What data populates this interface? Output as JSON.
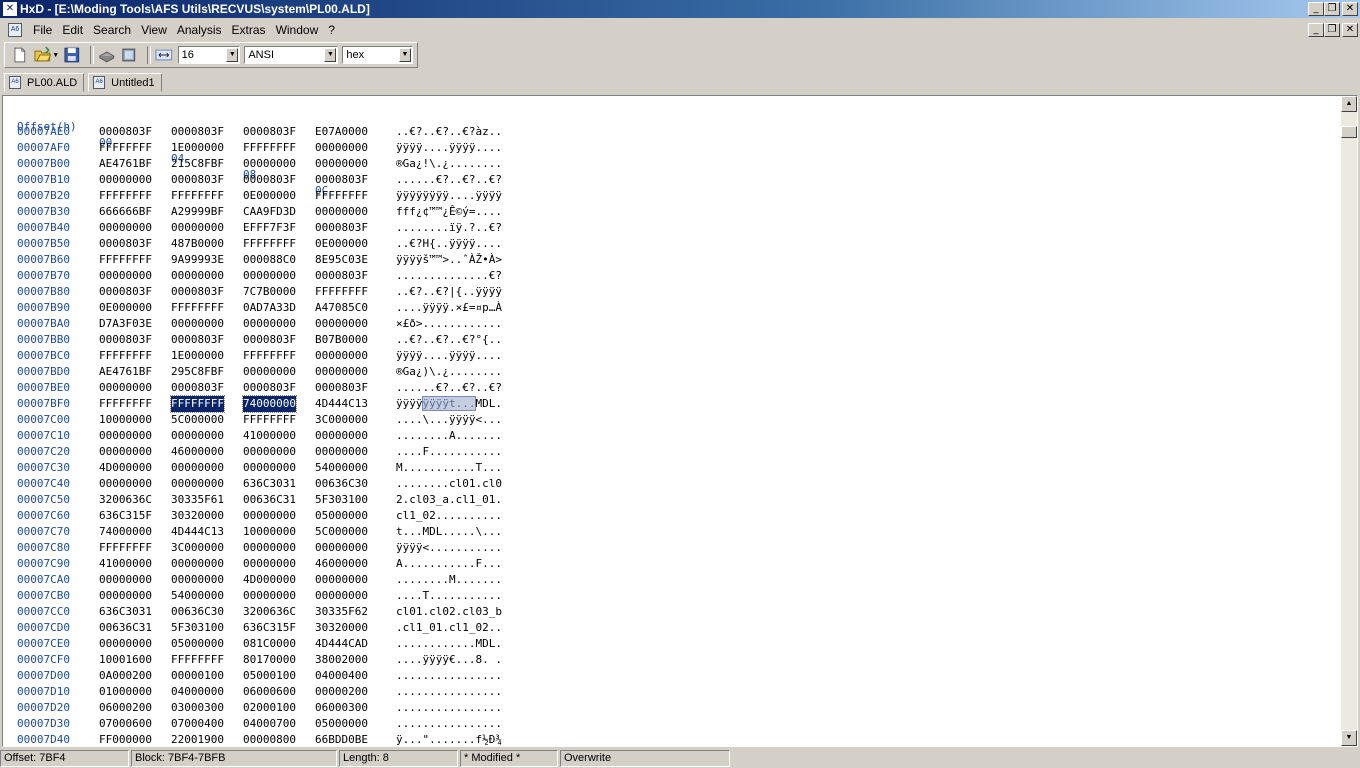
{
  "window": {
    "title": "HxD - [E:\\Moding Tools\\AFS Utils\\RECVUS\\system\\PL00.ALD]"
  },
  "menu": [
    "File",
    "Edit",
    "Search",
    "View",
    "Analysis",
    "Extras",
    "Window",
    "?"
  ],
  "toolbar": {
    "bytes_per_row": "16",
    "charset": "ANSI",
    "offset_base": "hex"
  },
  "tabs": [
    "PL00.ALD",
    "Untitled1"
  ],
  "hex": {
    "header": {
      "offset": "Offset(h)",
      "cols": [
        "00",
        "04",
        "08",
        "0C"
      ]
    },
    "selection": {
      "offset": "00007BF0",
      "groups": [
        1,
        2
      ],
      "ascii": "ÿÿÿÿt..."
    },
    "rows": [
      {
        "offset": "00007AE0",
        "groups": [
          "0000803F",
          "0000803F",
          "0000803F",
          "E07A0000"
        ],
        "ascii": "..€?..€?..€?àz.."
      },
      {
        "offset": "00007AF0",
        "groups": [
          "FFFFFFFF",
          "1E000000",
          "FFFFFFFF",
          "00000000"
        ],
        "ascii": "ÿÿÿÿ....ÿÿÿÿ...."
      },
      {
        "offset": "00007B00",
        "groups": [
          "AE4761BF",
          "215C8FBF",
          "00000000",
          "00000000"
        ],
        "ascii": "®Ga¿!\\.¿........"
      },
      {
        "offset": "00007B10",
        "groups": [
          "00000000",
          "0000803F",
          "0000803F",
          "0000803F"
        ],
        "ascii": "......€?..€?..€?"
      },
      {
        "offset": "00007B20",
        "groups": [
          "FFFFFFFF",
          "FFFFFFFF",
          "0E000000",
          "FFFFFFFF"
        ],
        "ascii": "ÿÿÿÿÿÿÿÿ....ÿÿÿÿ"
      },
      {
        "offset": "00007B30",
        "groups": [
          "666666BF",
          "A29999BF",
          "CAA9FD3D",
          "00000000"
        ],
        "ascii": "fff¿¢™™¿Ê©ý=...."
      },
      {
        "offset": "00007B40",
        "groups": [
          "00000000",
          "00000000",
          "EFFF7F3F",
          "0000803F"
        ],
        "ascii": "........ïÿ.?..€?"
      },
      {
        "offset": "00007B50",
        "groups": [
          "0000803F",
          "487B0000",
          "FFFFFFFF",
          "0E000000"
        ],
        "ascii": "..€?H{..ÿÿÿÿ...."
      },
      {
        "offset": "00007B60",
        "groups": [
          "FFFFFFFF",
          "9A99993E",
          "000088C0",
          "8E95C03E"
        ],
        "ascii": "ÿÿÿÿš™™>..ˆÀŽ•À>"
      },
      {
        "offset": "00007B70",
        "groups": [
          "00000000",
          "00000000",
          "00000000",
          "0000803F"
        ],
        "ascii": "..............€?"
      },
      {
        "offset": "00007B80",
        "groups": [
          "0000803F",
          "0000803F",
          "7C7B0000",
          "FFFFFFFF"
        ],
        "ascii": "..€?..€?|{..ÿÿÿÿ"
      },
      {
        "offset": "00007B90",
        "groups": [
          "0E000000",
          "FFFFFFFF",
          "0AD7A33D",
          "A47085C0"
        ],
        "ascii": "....ÿÿÿÿ.×£=¤p…À"
      },
      {
        "offset": "00007BA0",
        "groups": [
          "D7A3F03E",
          "00000000",
          "00000000",
          "00000000"
        ],
        "ascii": "×£ð>............"
      },
      {
        "offset": "00007BB0",
        "groups": [
          "0000803F",
          "0000803F",
          "0000803F",
          "B07B0000"
        ],
        "ascii": "..€?..€?..€?°{.."
      },
      {
        "offset": "00007BC0",
        "groups": [
          "FFFFFFFF",
          "1E000000",
          "FFFFFFFF",
          "00000000"
        ],
        "ascii": "ÿÿÿÿ....ÿÿÿÿ...."
      },
      {
        "offset": "00007BD0",
        "groups": [
          "AE4761BF",
          "295C8FBF",
          "00000000",
          "00000000"
        ],
        "ascii": "®Ga¿)\\.¿........"
      },
      {
        "offset": "00007BE0",
        "groups": [
          "00000000",
          "0000803F",
          "0000803F",
          "0000803F"
        ],
        "ascii": "......€?..€?..€?"
      },
      {
        "offset": "00007BF0",
        "groups": [
          "FFFFFFFF",
          "FFFFFFFF",
          "74000000",
          "4D444C13"
        ],
        "ascii": "ÿÿÿÿÿÿÿÿt...MDL."
      },
      {
        "offset": "00007C00",
        "groups": [
          "10000000",
          "5C000000",
          "FFFFFFFF",
          "3C000000"
        ],
        "ascii": "....\\...ÿÿÿÿ<..."
      },
      {
        "offset": "00007C10",
        "groups": [
          "00000000",
          "00000000",
          "41000000",
          "00000000"
        ],
        "ascii": "........A......."
      },
      {
        "offset": "00007C20",
        "groups": [
          "00000000",
          "46000000",
          "00000000",
          "00000000"
        ],
        "ascii": "....F..........."
      },
      {
        "offset": "00007C30",
        "groups": [
          "4D000000",
          "00000000",
          "00000000",
          "54000000"
        ],
        "ascii": "M...........T..."
      },
      {
        "offset": "00007C40",
        "groups": [
          "00000000",
          "00000000",
          "636C3031",
          "00636C30"
        ],
        "ascii": "........cl01.cl0"
      },
      {
        "offset": "00007C50",
        "groups": [
          "3200636C",
          "30335F61",
          "00636C31",
          "5F303100"
        ],
        "ascii": "2.cl03_a.cl1_01."
      },
      {
        "offset": "00007C60",
        "groups": [
          "636C315F",
          "30320000",
          "00000000",
          "05000000"
        ],
        "ascii": "cl1_02.........."
      },
      {
        "offset": "00007C70",
        "groups": [
          "74000000",
          "4D444C13",
          "10000000",
          "5C000000"
        ],
        "ascii": "t...MDL.....\\..."
      },
      {
        "offset": "00007C80",
        "groups": [
          "FFFFFFFF",
          "3C000000",
          "00000000",
          "00000000"
        ],
        "ascii": "ÿÿÿÿ<..........."
      },
      {
        "offset": "00007C90",
        "groups": [
          "41000000",
          "00000000",
          "00000000",
          "46000000"
        ],
        "ascii": "A...........F..."
      },
      {
        "offset": "00007CA0",
        "groups": [
          "00000000",
          "00000000",
          "4D000000",
          "00000000"
        ],
        "ascii": "........M......."
      },
      {
        "offset": "00007CB0",
        "groups": [
          "00000000",
          "54000000",
          "00000000",
          "00000000"
        ],
        "ascii": "....T..........."
      },
      {
        "offset": "00007CC0",
        "groups": [
          "636C3031",
          "00636C30",
          "3200636C",
          "30335F62"
        ],
        "ascii": "cl01.cl02.cl03_b"
      },
      {
        "offset": "00007CD0",
        "groups": [
          "00636C31",
          "5F303100",
          "636C315F",
          "30320000"
        ],
        "ascii": ".cl1_01.cl1_02.."
      },
      {
        "offset": "00007CE0",
        "groups": [
          "00000000",
          "05000000",
          "081C0000",
          "4D444CAD"
        ],
        "ascii": "............MDL."
      },
      {
        "offset": "00007CF0",
        "groups": [
          "10001600",
          "FFFFFFFF",
          "80170000",
          "38002000"
        ],
        "ascii": "....ÿÿÿÿ€...8. ."
      },
      {
        "offset": "00007D00",
        "groups": [
          "0A000200",
          "00000100",
          "05000100",
          "04000400"
        ],
        "ascii": "................"
      },
      {
        "offset": "00007D10",
        "groups": [
          "01000000",
          "04000000",
          "06000600",
          "00000200"
        ],
        "ascii": "................"
      },
      {
        "offset": "00007D20",
        "groups": [
          "06000200",
          "03000300",
          "02000100",
          "06000300"
        ],
        "ascii": "................"
      },
      {
        "offset": "00007D30",
        "groups": [
          "07000600",
          "07000400",
          "04000700",
          "05000000"
        ],
        "ascii": "................"
      },
      {
        "offset": "00007D40",
        "groups": [
          "FF000000",
          "22001900",
          "00000800",
          "66BDD0BE"
        ],
        "ascii": "ÿ...\".......f½Ð¾"
      }
    ]
  },
  "status": {
    "offset": "Offset: 7BF4",
    "block": "Block: 7BF4-7BFB",
    "length": "Length: 8",
    "modified": "* Modified *",
    "mode": "Overwrite"
  }
}
